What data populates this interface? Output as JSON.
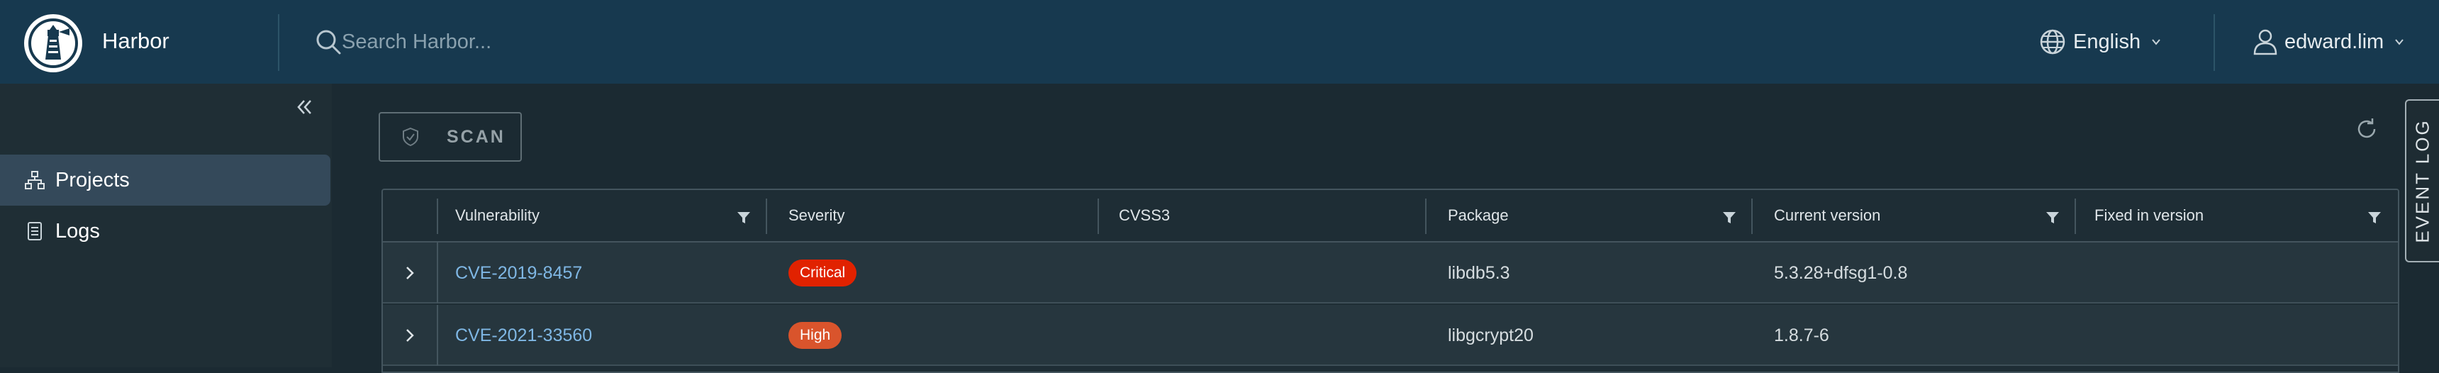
{
  "header": {
    "brand": "Harbor",
    "search_placeholder": "Search Harbor...",
    "language": "English",
    "user": "edward.lim"
  },
  "sidebar": {
    "items": [
      {
        "label": "Projects",
        "icon": "projects-icon",
        "active": true
      },
      {
        "label": "Logs",
        "icon": "logs-icon",
        "active": false
      }
    ]
  },
  "toolbar": {
    "scan_label": "SCAN"
  },
  "event_log": {
    "label": "EVENT LOG"
  },
  "table": {
    "columns": [
      "Vulnerability",
      "Severity",
      "CVSS3",
      "Package",
      "Current version",
      "Fixed in version"
    ],
    "rows": [
      {
        "vulnerability": "CVE-2019-8457",
        "severity": "Critical",
        "severity_color": "#e12200",
        "cvss3": "",
        "package": "libdb5.3",
        "current_version": "5.3.28+dfsg1-0.8",
        "fixed_version": ""
      },
      {
        "vulnerability": "CVE-2021-33560",
        "severity": "High",
        "severity_color": "#d9542c",
        "cvss3": "",
        "package": "libgcrypt20",
        "current_version": "1.8.7-6",
        "fixed_version": ""
      }
    ]
  },
  "colors": {
    "header_bg": "#17394f",
    "sidebar_bg": "#1f2e35",
    "main_bg": "#1b2a32",
    "link": "#7fb7e4"
  }
}
